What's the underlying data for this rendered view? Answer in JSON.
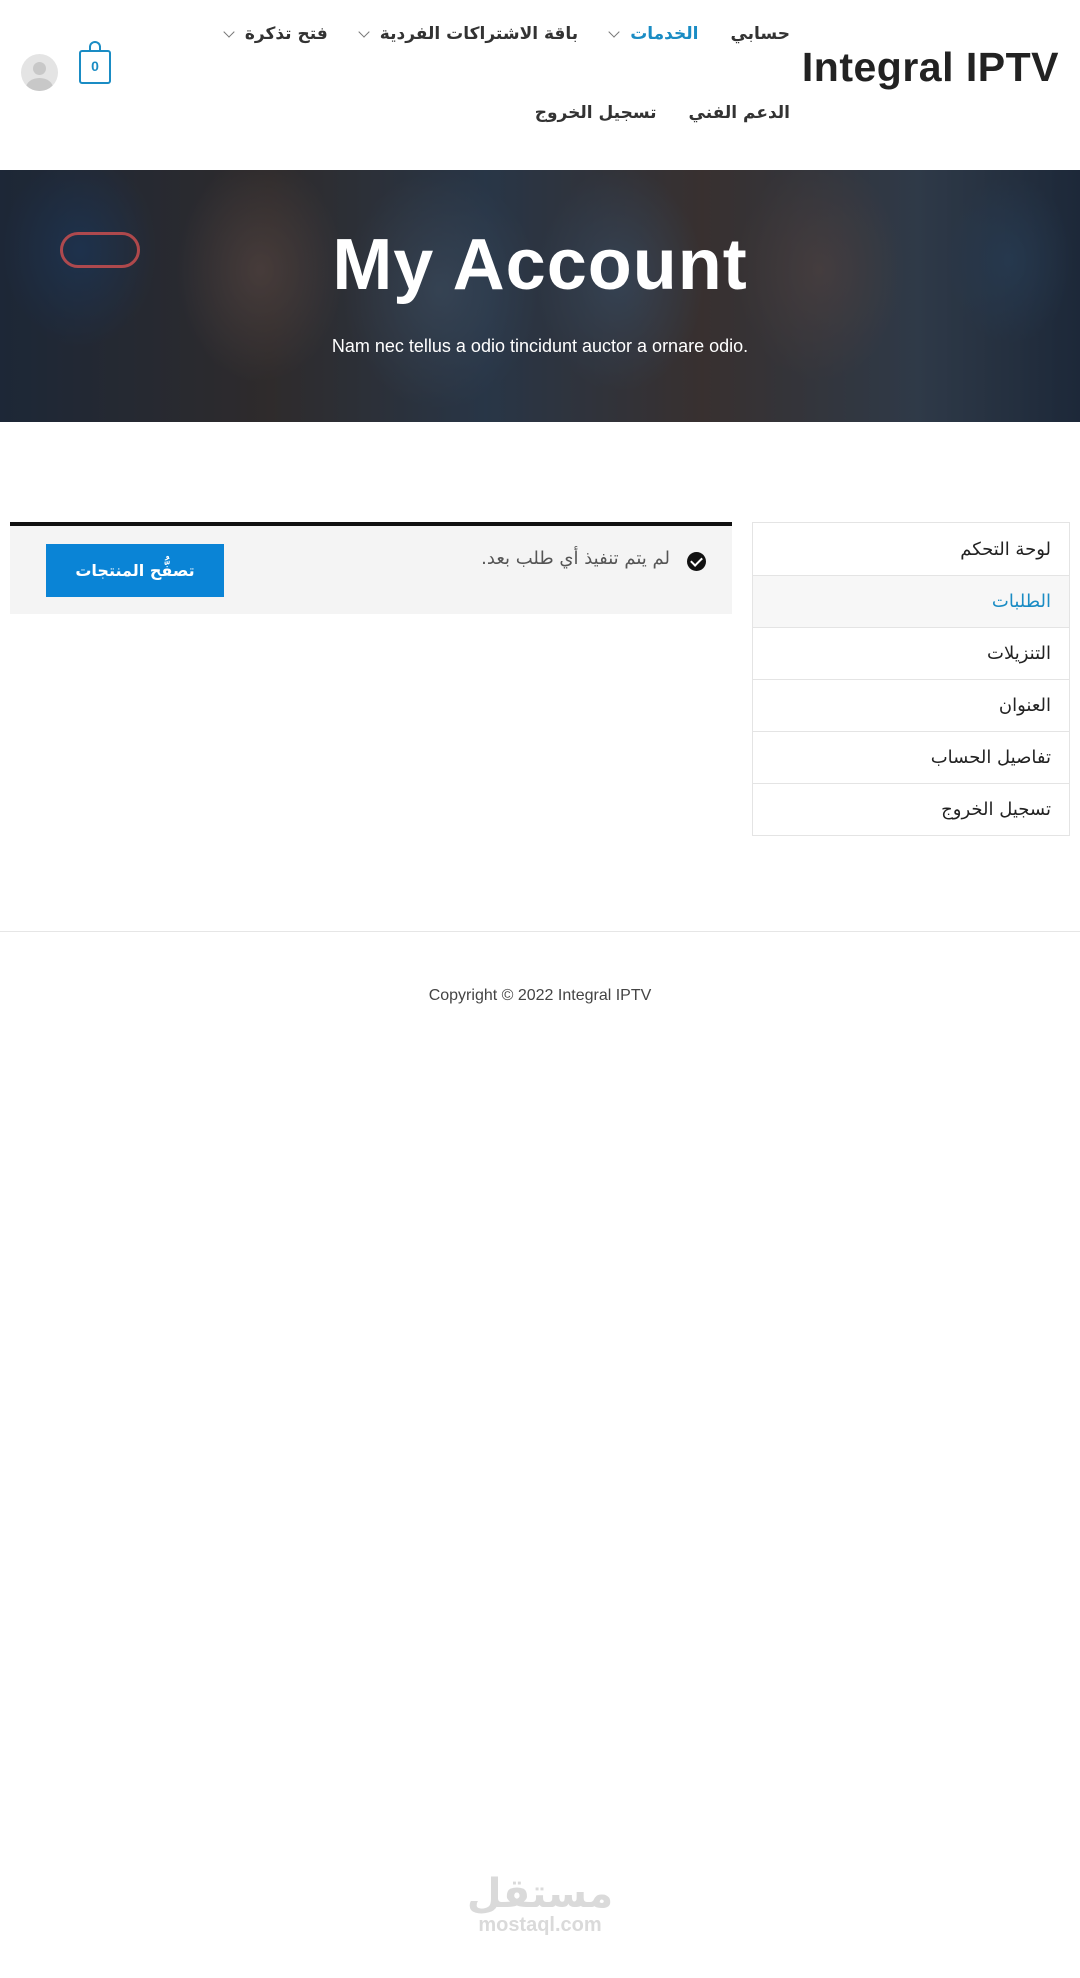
{
  "header": {
    "logo": "Integral IPTV",
    "nav_row1": [
      {
        "label": "حسابي",
        "dropdown": false,
        "active": false
      },
      {
        "label": "الخدمات",
        "dropdown": true,
        "active": true
      },
      {
        "label": "باقة الاشتراكات الفردية",
        "dropdown": true,
        "active": false
      },
      {
        "label": "فتح تذكرة",
        "dropdown": true,
        "active": false
      }
    ],
    "nav_row2": [
      {
        "label": "الدعم الفني"
      },
      {
        "label": "تسجيل الخروج"
      }
    ],
    "cart_count": "0",
    "accent_color": "#1a8cc4"
  },
  "hero": {
    "title": "My Account",
    "subtitle": "Nam nec tellus a odio tincidunt auctor a ornare odio."
  },
  "account_nav": [
    {
      "label": "لوحة التحكم",
      "active": false
    },
    {
      "label": "الطلبات",
      "active": true
    },
    {
      "label": "التنزيلات",
      "active": false
    },
    {
      "label": "العنوان",
      "active": false
    },
    {
      "label": "تفاصيل الحساب",
      "active": false
    },
    {
      "label": "تسجيل الخروج",
      "active": false
    }
  ],
  "notice": {
    "message": "لم يتم تنفيذ أي طلب بعد.",
    "button_label": "تصفُّح المنتجات",
    "button_color": "#0a84d6"
  },
  "footer": {
    "copyright": "Copyright © 2022 Integral IPTV"
  },
  "watermark": {
    "arabic": "مستقل",
    "latin": "mostaql.com"
  }
}
